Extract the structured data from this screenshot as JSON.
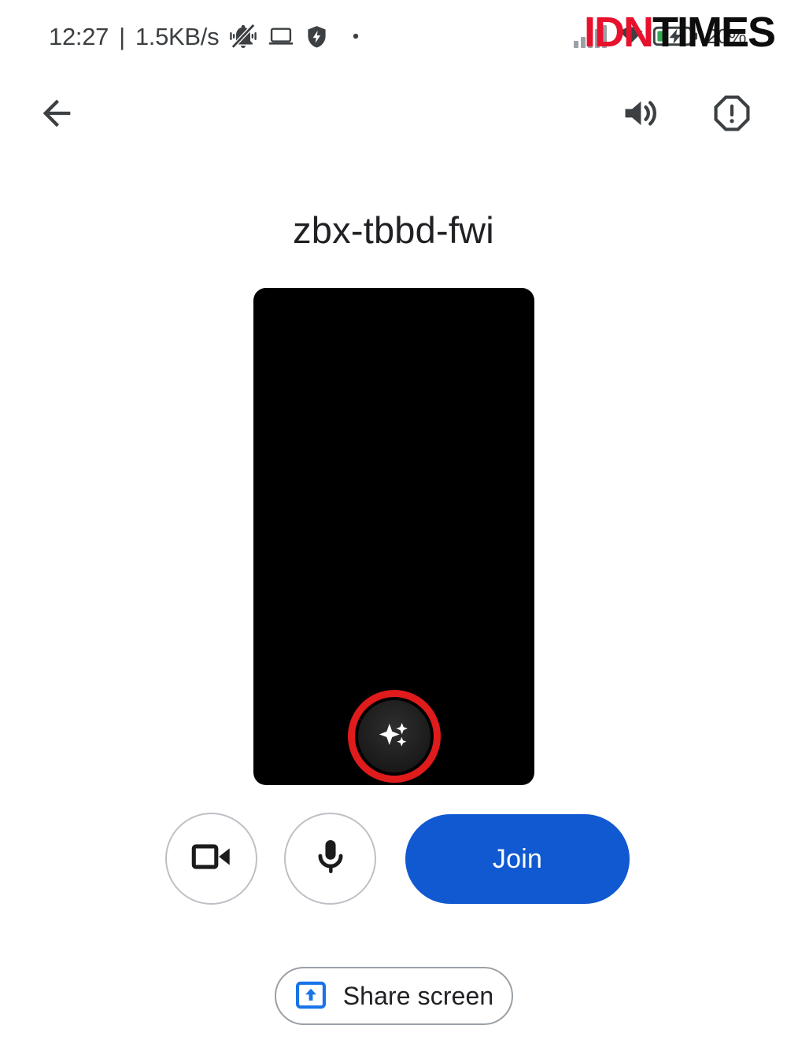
{
  "status_bar": {
    "clock": "12:27",
    "separator": "|",
    "network_speed": "1.5KB/s",
    "icons": [
      {
        "name": "vibrate-off-icon"
      },
      {
        "name": "laptop-icon"
      },
      {
        "name": "shield-bolt-icon"
      },
      {
        "name": "dot-indicator-icon"
      }
    ],
    "right_icons": [
      {
        "name": "signal-bars-icon"
      },
      {
        "name": "wifi-icon"
      },
      {
        "name": "battery-charging-icon"
      }
    ],
    "battery_percent": "20%"
  },
  "watermark": {
    "part1": "IDN",
    "part2": "TIMES"
  },
  "app_bar": {
    "back_label": "Back",
    "sound_label": "Sound",
    "report_label": "Report a problem"
  },
  "meeting": {
    "code": "zbx-tbbd-fwi"
  },
  "preview": {
    "effects_label": "Apply visual effects",
    "annotation_color": "#e01b1b"
  },
  "controls": {
    "camera_label": "Turn off camera",
    "mic_label": "Turn off microphone",
    "join_label": "Join"
  },
  "share": {
    "label": "Share screen"
  },
  "colors": {
    "accent_blue": "#1159d0",
    "icon_gray": "#3c4043",
    "text_primary": "#202124",
    "border_gray": "#9aa0a6",
    "annotation_red": "#e01b1b",
    "brand_red": "#e8112d",
    "battery_green": "#34a853"
  }
}
